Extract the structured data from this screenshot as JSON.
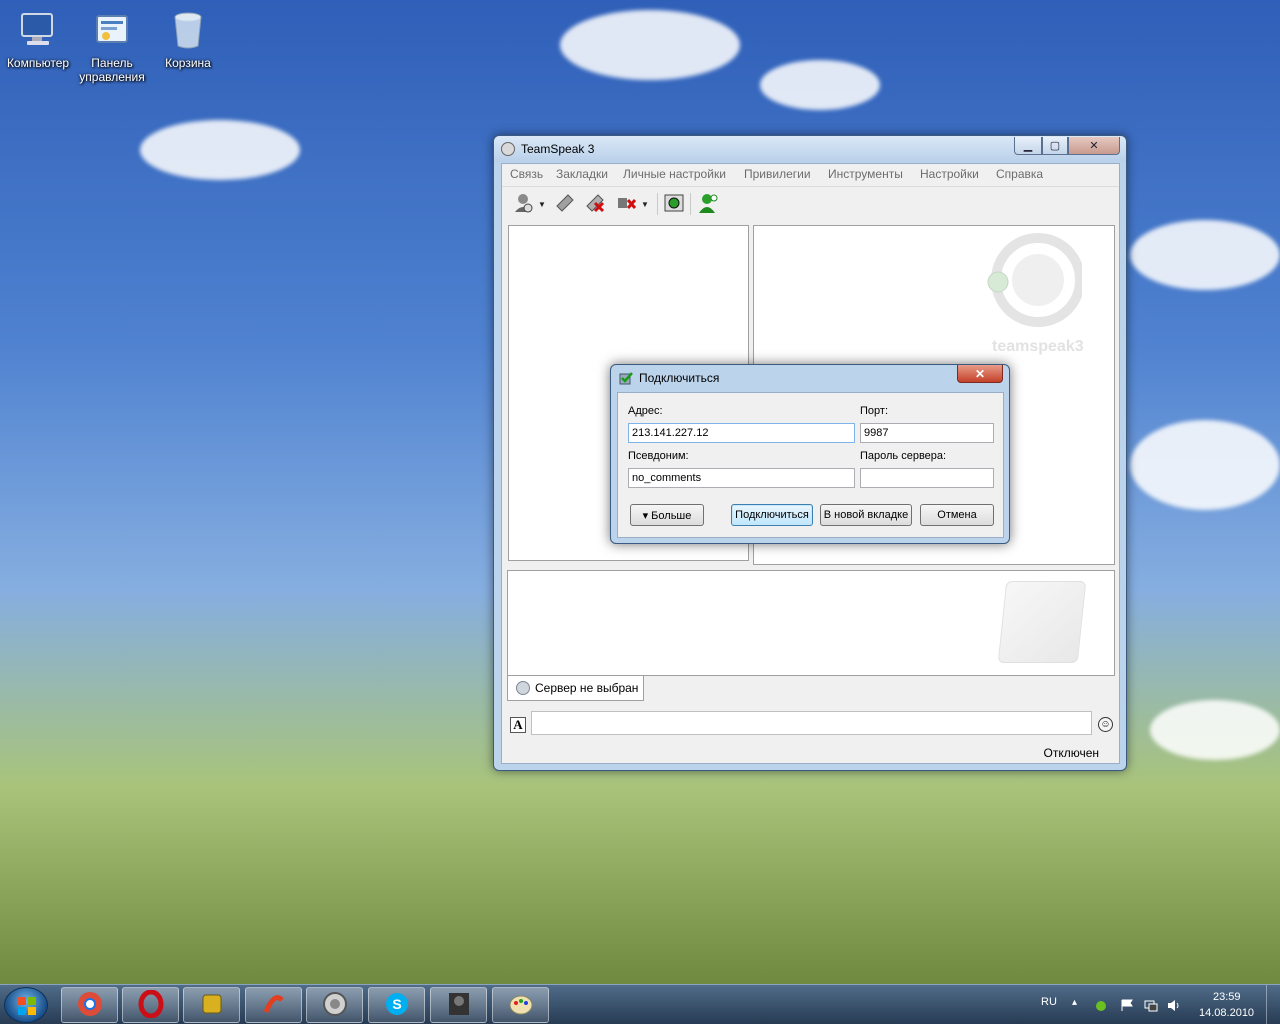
{
  "desktop": {
    "icons": [
      {
        "name": "computer",
        "label": "Компьютер"
      },
      {
        "name": "control-panel",
        "label": "Панель управления"
      },
      {
        "name": "recycle-bin",
        "label": "Корзина"
      }
    ]
  },
  "main_window": {
    "title": "TeamSpeak 3",
    "controls": {
      "minimize": "▁",
      "maximize": "▢",
      "close": "✕"
    },
    "menu": [
      "Связь",
      "Закладки",
      "Личные настройки",
      "Привилегии",
      "Инструменты",
      "Настройки",
      "Справка"
    ],
    "watermark_text": "teamspeak3",
    "tab_label": "Сервер не выбран",
    "chat_input_value": "",
    "font_button": "A",
    "smiley_button": "☺",
    "status": "Отключен"
  },
  "connect_dialog": {
    "title": "Подключиться",
    "close_glyph": "✕",
    "address_label": "Адрес:",
    "address_value": "213.141.227.12",
    "port_label": "Порт:",
    "port_value": "9987",
    "nickname_label": "Псевдоним:",
    "nickname_value": "no_comments",
    "password_label": "Пароль сервера:",
    "password_value": "",
    "more_button": "▾ Больше",
    "connect_button": "Подключиться",
    "new_tab_button": "В новой вкладке",
    "cancel_button": "Отмена"
  },
  "taskbar": {
    "language": "RU",
    "time": "23:59",
    "date": "14.08.2010",
    "tray_arrow": "▴",
    "colors": {
      "chrome": "#dd4b39",
      "opera": "#cc0f16",
      "skype": "#00aff0"
    }
  }
}
